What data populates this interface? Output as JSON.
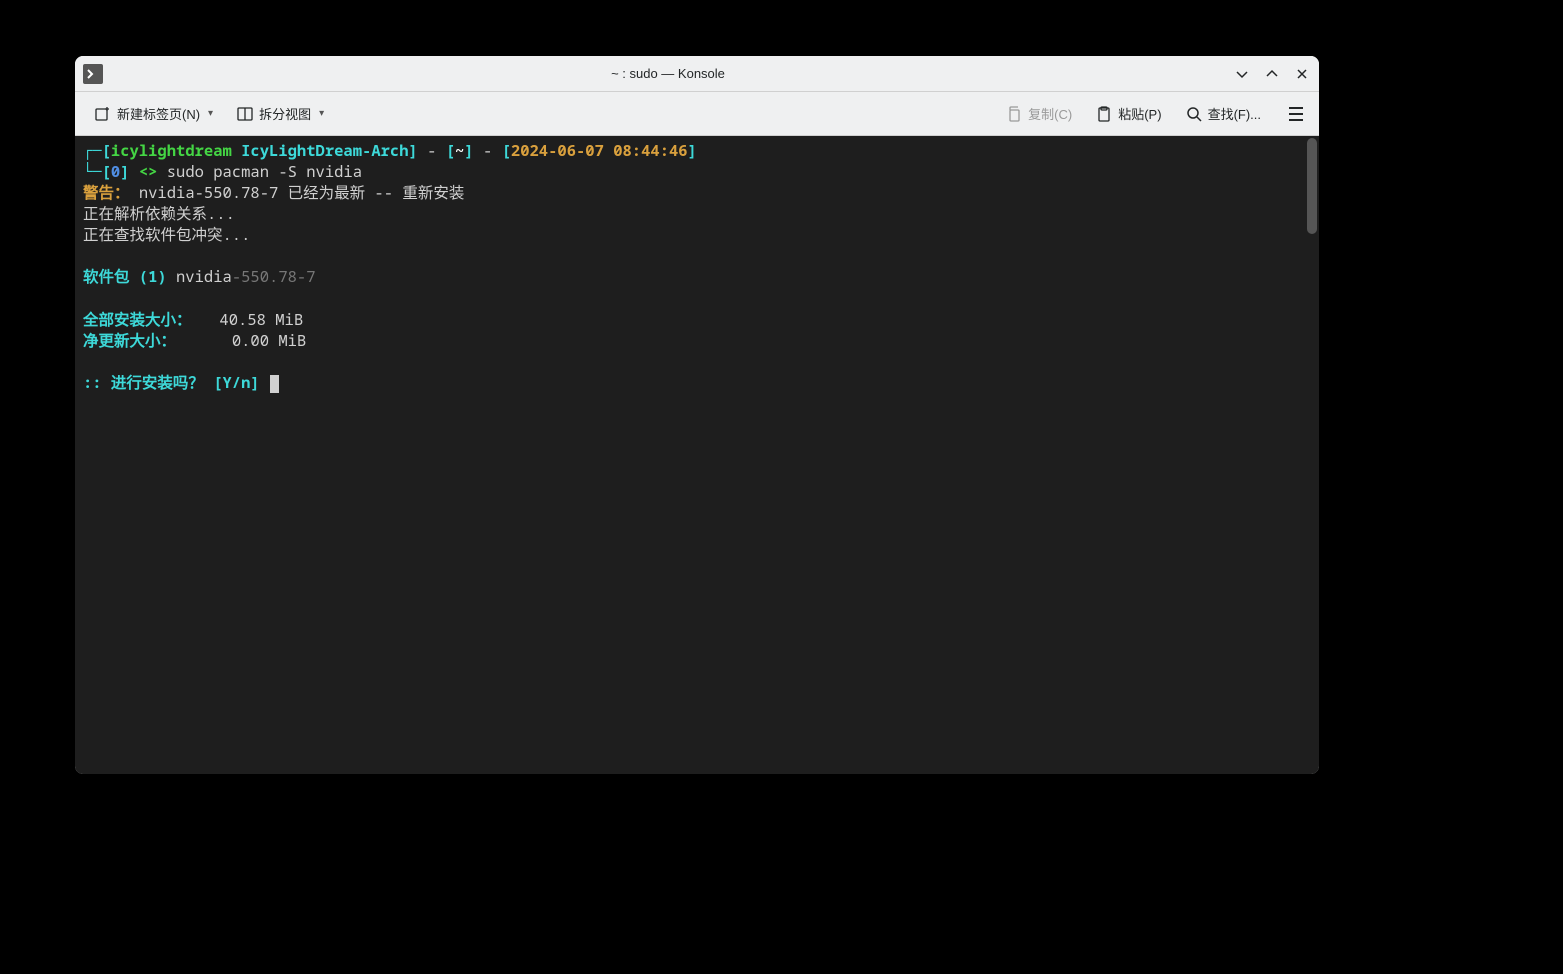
{
  "titlebar": {
    "title": "~ : sudo — Konsole"
  },
  "toolbar": {
    "new_tab": "新建标签页(N)",
    "split_view": "拆分视图",
    "copy": "复制(C)",
    "paste": "粘贴(P)",
    "find": "查找(F)..."
  },
  "terminal": {
    "prompt_open": "┌─[",
    "user": "icylightdream",
    "host": " IcyLightDream-Arch",
    "prompt_close_host": "]",
    "sep1": " - ",
    "cwd_open": "[",
    "cwd": "~",
    "cwd_close": "]",
    "sep2": " - ",
    "time_open": "[",
    "timestamp": "2024-06-07 08:44:46",
    "time_close": "]",
    "line2_open": "└─[",
    "exit_code": "0",
    "line2_close": "]",
    "prompt_symbol": " <> ",
    "command": "sudo pacman -S nvidia",
    "warn_label": "警告：",
    "warn_msg": " nvidia-550.78-7 已经为最新 -- 重新安装",
    "resolving": "正在解析依赖关系...",
    "conflicts": "正在查找软件包冲突...",
    "pkg_label": "软件包 (1)",
    "pkg_name": " nvidia",
    "pkg_ver": "-550.78-7",
    "size_total_label": "全部安装大小：",
    "size_total_val": "   40.58 MiB",
    "size_net_label": "净更新大小：",
    "size_net_val": "      0.00 MiB",
    "confirm": ":: 进行安装吗？ [Y/n] "
  }
}
